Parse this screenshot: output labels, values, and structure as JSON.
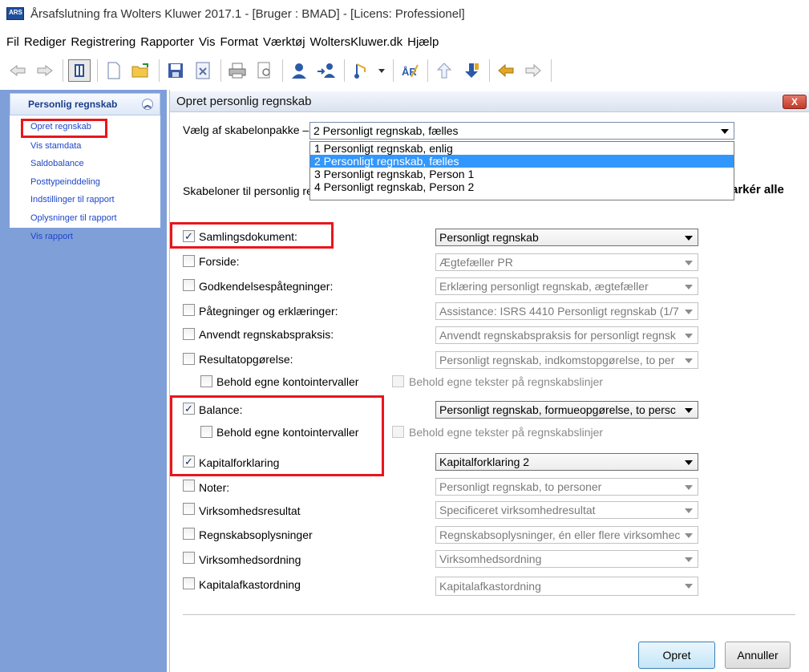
{
  "window": {
    "title": "Årsafslutning fra Wolters Kluwer 2017.1 - [Bruger : BMAD] - [Licens: Professionel]",
    "app_icon_text": "ARS"
  },
  "menu": [
    "Fil",
    "Rediger",
    "Registrering",
    "Rapporter",
    "Vis",
    "Format",
    "Værktøj",
    "WoltersKluwer.dk",
    "Hjælp"
  ],
  "toolbar_icons": [
    "back-arrow-icon",
    "forward-arrow-icon",
    "panel-toggle-icon",
    "new-document-icon",
    "open-folder-icon",
    "save-icon",
    "close-document-icon",
    "print-icon",
    "print-preview-icon",
    "user-icon",
    "users-transfer-icon",
    "note-icon",
    "note-dropdown-icon",
    "ar-icon",
    "upload-icon",
    "download-icon",
    "shift-left-icon",
    "shift-right-icon"
  ],
  "sidebar": {
    "header": "Personlig regnskab",
    "items": [
      "Opret regnskab",
      "Vis stamdata",
      "Saldobalance",
      "Posttypeinddeling",
      "Indstillinger til rapport",
      "Oplysninger til rapport",
      "Vis rapport"
    ]
  },
  "dialog": {
    "title": "Opret personlig regnskab",
    "close_label": "X",
    "package_label": "Vælg af skabelonpakke",
    "package_selected": "2 Personligt regnskab, fælles",
    "package_options": [
      "1 Personligt regnskab, enlig",
      "2 Personligt regnskab, fælles",
      "3 Personligt regnskab, Person 1",
      "4 Personligt regnskab, Person 2"
    ],
    "templates_label": "Skabeloner til personlig re",
    "mark_all": "arkér alle",
    "rows": [
      {
        "label": "Samlingsdokument:",
        "checked": true,
        "value": "Personligt regnskab"
      },
      {
        "label": "Forside:",
        "checked": false,
        "value": "Ægtefæller PR"
      },
      {
        "label": "Godkendelsespåtegninger:",
        "checked": false,
        "value": "Erklæring personligt regnskab, ægtefæller"
      },
      {
        "label": "Påtegninger og erklæringer:",
        "checked": false,
        "value": "Assistance: ISRS 4410 Personligt regnskab (1/7"
      },
      {
        "label": "Anvendt regnskabspraksis:",
        "checked": false,
        "value": "Anvendt regnskabspraksis for personligt regnsk"
      },
      {
        "label": "Resultatopgørelse:",
        "checked": false,
        "value": "Personligt regnskab, indkomstopgørelse, to per"
      },
      {
        "label": "Balance:",
        "checked": true,
        "value": "Personligt regnskab, formueopgørelse, to persc"
      },
      {
        "label": "Kapitalforklaring",
        "checked": true,
        "value": "Kapitalforklaring 2"
      },
      {
        "label": "Noter:",
        "checked": false,
        "value": "Personligt regnskab, to personer"
      },
      {
        "label": "Virksomhedsresultat",
        "checked": false,
        "value": "Specificeret virksomhedresultat"
      },
      {
        "label": "Regnskabsoplysninger",
        "checked": false,
        "value": "Regnskabsoplysninger, én eller flere virksomhec"
      },
      {
        "label": "Virksomhedsordning",
        "checked": false,
        "value": "Virksomhedsordning"
      },
      {
        "label": "Kapitalafkastordning",
        "checked": false,
        "value": "Kapitalafkastordning"
      }
    ],
    "sub_options": {
      "keep_accounts": "Behold egne kontointervaller",
      "keep_texts": "Behold egne tekster på regnskabslinjer"
    },
    "buttons": {
      "create": "Opret",
      "cancel": "Annuller"
    }
  }
}
